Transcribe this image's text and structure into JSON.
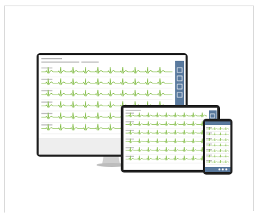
{
  "colors": {
    "ecg_green": "#7ab83a",
    "panel_blue": "#5a7a9e",
    "bezel": "#1e1e1e",
    "stand": "#c8c8c8",
    "frame_border": "#d9d9d9"
  },
  "devices": {
    "monitor": {
      "leads": 6,
      "icons": [
        "zoom-icon",
        "filter-icon",
        "upload-icon",
        "print-icon"
      ]
    },
    "tablet": {
      "leads": 6,
      "icons": [
        "zoom-icon",
        "filter-icon",
        "upload-icon",
        "print-icon"
      ]
    },
    "phone": {
      "leads": 7,
      "icons": [
        "settings-icon",
        "share-icon",
        "expand-icon"
      ]
    }
  }
}
